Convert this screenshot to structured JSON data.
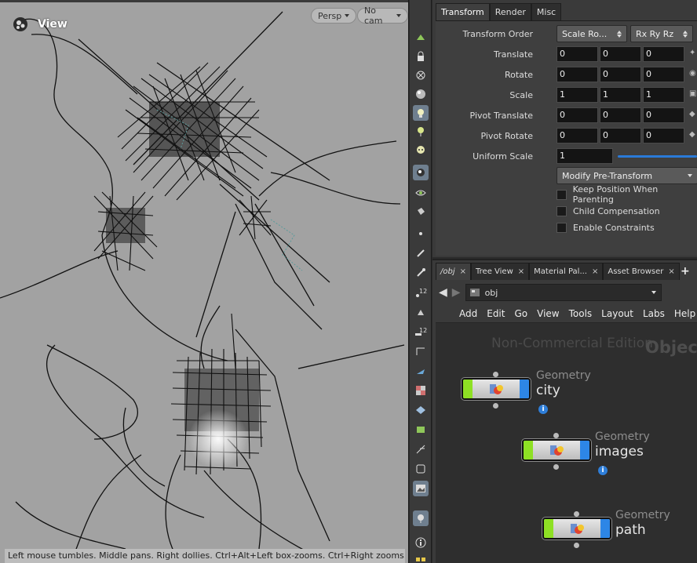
{
  "viewport": {
    "title": "View",
    "persp_label": "Persp",
    "cam_label": "No cam",
    "status": "Left mouse tumbles. Middle pans. Right dollies. Ctrl+Alt+Left box-zooms. Ctrl+Right zooms. Spacebar-"
  },
  "toolbar": {
    "icons": [
      "display-options-icon",
      "lock-camera-icon",
      "remove-icon",
      "sphere-shading-icon",
      "light-icon",
      "pin-light-icon",
      "skull-icon",
      "camera-icon",
      "eye-icon",
      "paint-bucket-icon",
      "point-icon",
      "brush-icon",
      "dropper-icon",
      "ruler-12-icon",
      "tool-icon",
      "ruler-12b-icon",
      "curve-icon",
      "normals-icon",
      "checker-icon",
      "layer-icon",
      "network-icon",
      "snap-icon",
      "frame-icon",
      "image-icon",
      "map-pin-icon",
      "info-icon"
    ]
  },
  "params": {
    "tabs": [
      "Transform",
      "Render",
      "Misc"
    ],
    "transform_order_label": "Transform Order",
    "transform_order_value": "Scale Ro...",
    "rotate_order_value": "Rx Ry Rz",
    "rows": [
      {
        "label": "Translate",
        "values": [
          "0",
          "0",
          "0"
        ]
      },
      {
        "label": "Rotate",
        "values": [
          "0",
          "0",
          "0"
        ]
      },
      {
        "label": "Scale",
        "values": [
          "1",
          "1",
          "1"
        ]
      },
      {
        "label": "Pivot Translate",
        "values": [
          "0",
          "0",
          "0"
        ]
      },
      {
        "label": "Pivot Rotate",
        "values": [
          "0",
          "0",
          "0"
        ]
      }
    ],
    "uniform_scale_label": "Uniform Scale",
    "uniform_scale_value": "1",
    "modify_label": "Modify Pre-Transform",
    "checkboxes": [
      "Keep Position When Parenting",
      "Child Compensation",
      "Enable Constraints"
    ]
  },
  "network": {
    "tabs": [
      "/obj",
      "Tree View",
      "Material Pal...",
      "Asset Browser"
    ],
    "path": "obj",
    "menu": [
      "Add",
      "Edit",
      "Go",
      "View",
      "Tools",
      "Layout",
      "Labs",
      "Help"
    ],
    "watermark": "Non-Commercial Edition",
    "context_label": "Objec",
    "nodes": [
      {
        "type": "Geometry",
        "name": "city"
      },
      {
        "type": "Geometry",
        "name": "images"
      },
      {
        "type": "Geometry",
        "name": "path"
      }
    ]
  },
  "colors": {
    "viewport_bg": "#a2a2a2",
    "panel_bg": "#3a3a3a",
    "node_green": "#8ee024",
    "node_blue": "#2d86e6",
    "info_blue": "#2e7ed9"
  }
}
